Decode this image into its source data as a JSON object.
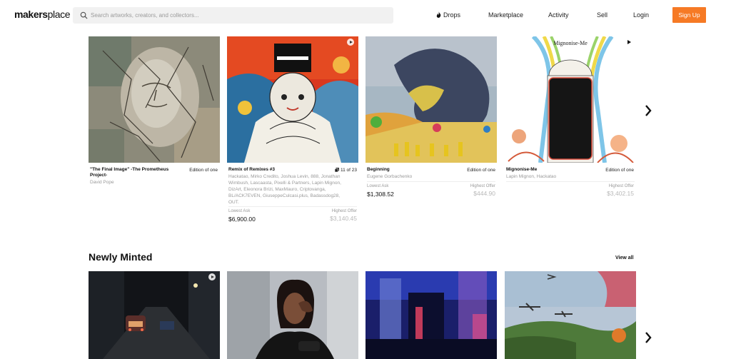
{
  "header": {
    "logo_bold": "makers",
    "logo_rest": "place",
    "search_placeholder": "Search artworks, creators, and collectors...",
    "nav": {
      "drops": "Drops",
      "marketplace": "Marketplace",
      "activity": "Activity",
      "sell": "Sell",
      "login": "Login"
    },
    "signup": "Sign Up",
    "accent_color": "#f67a25"
  },
  "featured": {
    "cards": [
      {
        "title": "\"The Final Image\" -The Prometheus Project-",
        "edition": "Edition of one",
        "creator": "David Pope"
      },
      {
        "title": "Remix of Remixes #3",
        "edition": "11 of 23",
        "creator": "Hackatao, Mirko Credito, Joshua Levin, 888, Jonathan Wimbush, Lascaasta, Pixelli & Partners, Lapin Mignon, DizArt, Eleonora Brizi, MaxMauro, Criptovanga, BL/ACK7EVEN, GiuseppeCulcasi.plus, Badassdog28, OUT.",
        "lowest_ask_label": "Lowest Ask",
        "lowest_ask": "$6,900.00",
        "highest_offer_label": "Highest Offer",
        "highest_offer": "$3,140.45"
      },
      {
        "title": "Beginning",
        "edition": "Edition of one",
        "creator": "Eugene Gorbachenko",
        "lowest_ask_label": "Lowest Ask",
        "lowest_ask": "$1,308.52",
        "highest_offer_label": "Highest Offer",
        "highest_offer": "$444.90"
      },
      {
        "title": "Mignonise-Me",
        "edition": "Edition of one",
        "creator": "Lapin Mignon, Hackatao",
        "highest_offer_label": "Highest Offer",
        "highest_offer": "$3,402.15"
      }
    ]
  },
  "newly_minted": {
    "title": "Newly Minted",
    "view_all": "View all"
  }
}
